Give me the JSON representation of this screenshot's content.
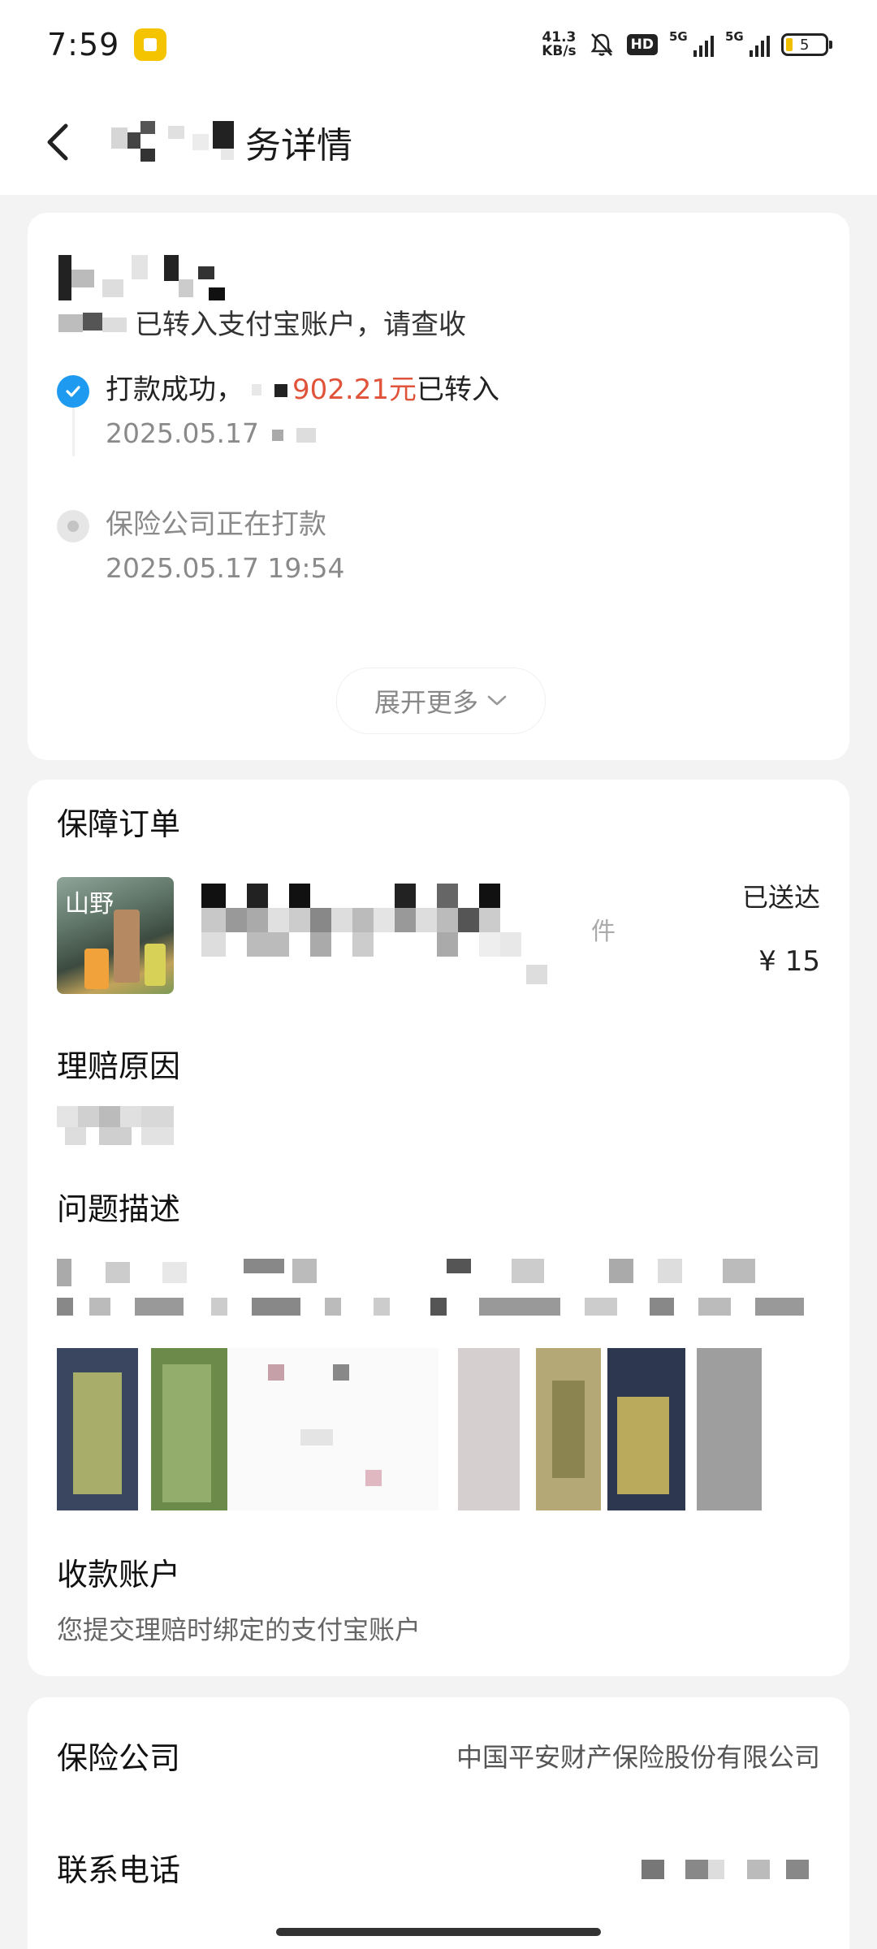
{
  "status_bar": {
    "time": "7:59",
    "speed_value": "41.3",
    "speed_unit": "KB/s",
    "hd_label": "HD",
    "net1": "5G",
    "net2": "5G",
    "battery": "5"
  },
  "nav": {
    "title_visible": "务详情"
  },
  "progress": {
    "subline": "已转入支付宝账户，请查收",
    "step1_prefix": "打款成功，",
    "step1_amount": "902.21元",
    "step1_suffix": "已转入",
    "step1_date": "2025.05.17",
    "step2_label": "保险公司正在打款",
    "step2_date": "2025.05.17 19:54",
    "expand_label": "展开更多"
  },
  "order": {
    "section_title": "保障订单",
    "thumb_text": "山野",
    "status": "已送达",
    "price": "¥ 15",
    "name_suffix": "件"
  },
  "claim": {
    "reason_title": "理赔原因",
    "description_title": "问题描述"
  },
  "account": {
    "title": "收款账户",
    "desc": "您提交理赔时绑定的支付宝账户"
  },
  "insurer": {
    "company_label": "保险公司",
    "company_value": "中国平安财产保险股份有限公司",
    "phone_label": "联系电话"
  },
  "colors": {
    "accent": "#1e9bf0",
    "amount": "#e0533a"
  }
}
